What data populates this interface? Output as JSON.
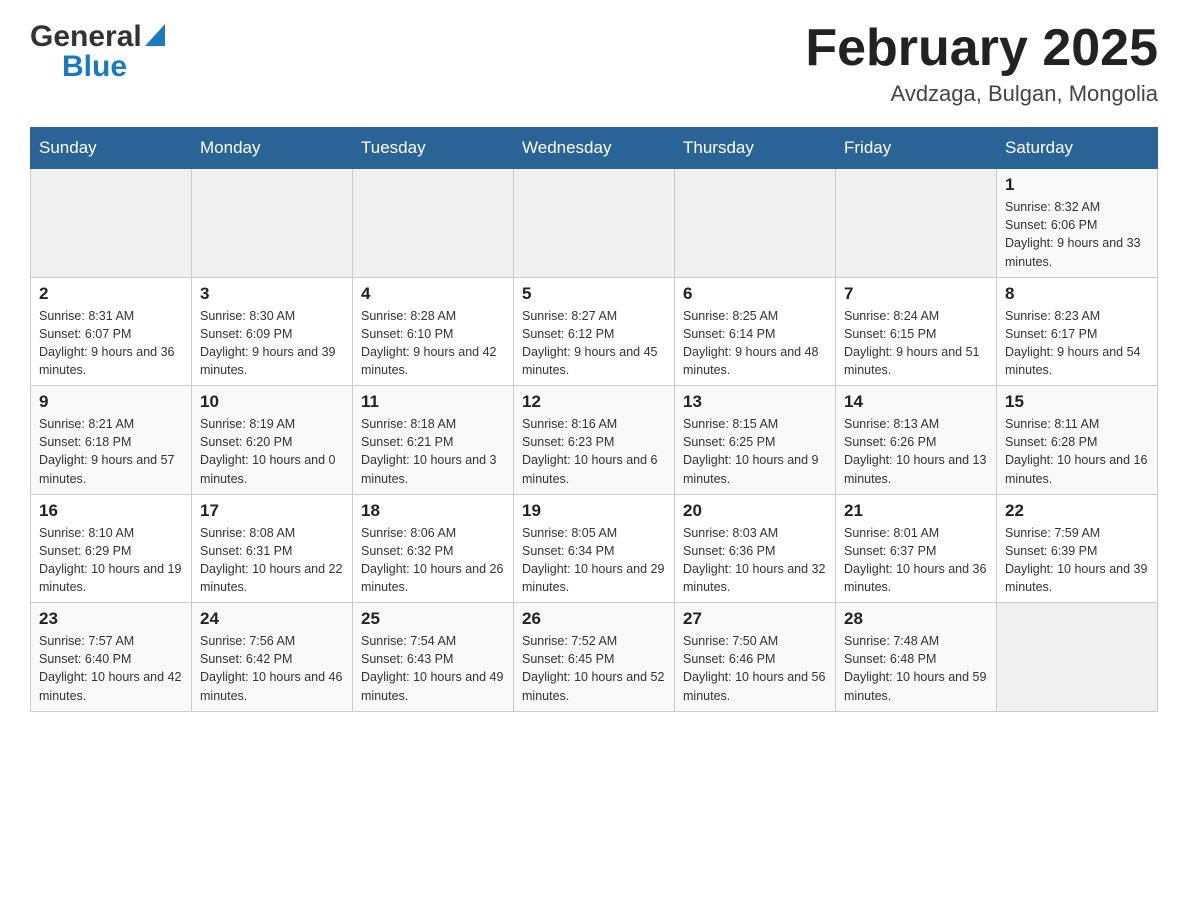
{
  "header": {
    "logo_general": "General",
    "logo_blue": "Blue",
    "month_title": "February 2025",
    "location": "Avdzaga, Bulgan, Mongolia"
  },
  "days_of_week": [
    "Sunday",
    "Monday",
    "Tuesday",
    "Wednesday",
    "Thursday",
    "Friday",
    "Saturday"
  ],
  "weeks": [
    [
      {
        "day": "",
        "info": ""
      },
      {
        "day": "",
        "info": ""
      },
      {
        "day": "",
        "info": ""
      },
      {
        "day": "",
        "info": ""
      },
      {
        "day": "",
        "info": ""
      },
      {
        "day": "",
        "info": ""
      },
      {
        "day": "1",
        "info": "Sunrise: 8:32 AM\nSunset: 6:06 PM\nDaylight: 9 hours and 33 minutes."
      }
    ],
    [
      {
        "day": "2",
        "info": "Sunrise: 8:31 AM\nSunset: 6:07 PM\nDaylight: 9 hours and 36 minutes."
      },
      {
        "day": "3",
        "info": "Sunrise: 8:30 AM\nSunset: 6:09 PM\nDaylight: 9 hours and 39 minutes."
      },
      {
        "day": "4",
        "info": "Sunrise: 8:28 AM\nSunset: 6:10 PM\nDaylight: 9 hours and 42 minutes."
      },
      {
        "day": "5",
        "info": "Sunrise: 8:27 AM\nSunset: 6:12 PM\nDaylight: 9 hours and 45 minutes."
      },
      {
        "day": "6",
        "info": "Sunrise: 8:25 AM\nSunset: 6:14 PM\nDaylight: 9 hours and 48 minutes."
      },
      {
        "day": "7",
        "info": "Sunrise: 8:24 AM\nSunset: 6:15 PM\nDaylight: 9 hours and 51 minutes."
      },
      {
        "day": "8",
        "info": "Sunrise: 8:23 AM\nSunset: 6:17 PM\nDaylight: 9 hours and 54 minutes."
      }
    ],
    [
      {
        "day": "9",
        "info": "Sunrise: 8:21 AM\nSunset: 6:18 PM\nDaylight: 9 hours and 57 minutes."
      },
      {
        "day": "10",
        "info": "Sunrise: 8:19 AM\nSunset: 6:20 PM\nDaylight: 10 hours and 0 minutes."
      },
      {
        "day": "11",
        "info": "Sunrise: 8:18 AM\nSunset: 6:21 PM\nDaylight: 10 hours and 3 minutes."
      },
      {
        "day": "12",
        "info": "Sunrise: 8:16 AM\nSunset: 6:23 PM\nDaylight: 10 hours and 6 minutes."
      },
      {
        "day": "13",
        "info": "Sunrise: 8:15 AM\nSunset: 6:25 PM\nDaylight: 10 hours and 9 minutes."
      },
      {
        "day": "14",
        "info": "Sunrise: 8:13 AM\nSunset: 6:26 PM\nDaylight: 10 hours and 13 minutes."
      },
      {
        "day": "15",
        "info": "Sunrise: 8:11 AM\nSunset: 6:28 PM\nDaylight: 10 hours and 16 minutes."
      }
    ],
    [
      {
        "day": "16",
        "info": "Sunrise: 8:10 AM\nSunset: 6:29 PM\nDaylight: 10 hours and 19 minutes."
      },
      {
        "day": "17",
        "info": "Sunrise: 8:08 AM\nSunset: 6:31 PM\nDaylight: 10 hours and 22 minutes."
      },
      {
        "day": "18",
        "info": "Sunrise: 8:06 AM\nSunset: 6:32 PM\nDaylight: 10 hours and 26 minutes."
      },
      {
        "day": "19",
        "info": "Sunrise: 8:05 AM\nSunset: 6:34 PM\nDaylight: 10 hours and 29 minutes."
      },
      {
        "day": "20",
        "info": "Sunrise: 8:03 AM\nSunset: 6:36 PM\nDaylight: 10 hours and 32 minutes."
      },
      {
        "day": "21",
        "info": "Sunrise: 8:01 AM\nSunset: 6:37 PM\nDaylight: 10 hours and 36 minutes."
      },
      {
        "day": "22",
        "info": "Sunrise: 7:59 AM\nSunset: 6:39 PM\nDaylight: 10 hours and 39 minutes."
      }
    ],
    [
      {
        "day": "23",
        "info": "Sunrise: 7:57 AM\nSunset: 6:40 PM\nDaylight: 10 hours and 42 minutes."
      },
      {
        "day": "24",
        "info": "Sunrise: 7:56 AM\nSunset: 6:42 PM\nDaylight: 10 hours and 46 minutes."
      },
      {
        "day": "25",
        "info": "Sunrise: 7:54 AM\nSunset: 6:43 PM\nDaylight: 10 hours and 49 minutes."
      },
      {
        "day": "26",
        "info": "Sunrise: 7:52 AM\nSunset: 6:45 PM\nDaylight: 10 hours and 52 minutes."
      },
      {
        "day": "27",
        "info": "Sunrise: 7:50 AM\nSunset: 6:46 PM\nDaylight: 10 hours and 56 minutes."
      },
      {
        "day": "28",
        "info": "Sunrise: 7:48 AM\nSunset: 6:48 PM\nDaylight: 10 hours and 59 minutes."
      },
      {
        "day": "",
        "info": ""
      }
    ]
  ]
}
